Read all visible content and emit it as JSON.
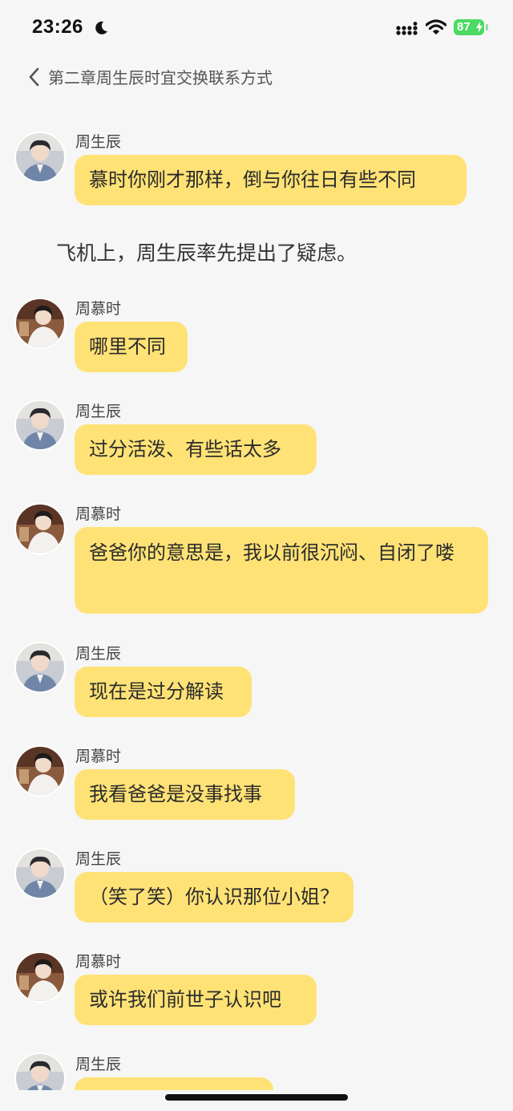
{
  "status_bar": {
    "time": "23:26",
    "battery_level": "87"
  },
  "nav": {
    "title": "第二章周生辰时宜交换联系方式"
  },
  "narration": "飞机上，周生辰率先提出了疑虑。",
  "messages": [
    {
      "speaker": "周生辰",
      "text": "慕时你刚才那样，倒与你往日有些不同"
    },
    {
      "speaker": "周慕时",
      "text": "哪里不同"
    },
    {
      "speaker": "周生辰",
      "text": "过分活泼、有些话太多"
    },
    {
      "speaker": "周慕时",
      "text": "爸爸你的意思是，我以前很沉闷、自闭了喽"
    },
    {
      "speaker": "周生辰",
      "text": "现在是过分解读"
    },
    {
      "speaker": "周慕时",
      "text": "我看爸爸是没事找事"
    },
    {
      "speaker": "周生辰",
      "text": "（笑了笑）你认识那位小姐？"
    },
    {
      "speaker": "周慕时",
      "text": "或许我们前世子认识吧"
    },
    {
      "speaker": "周生辰",
      "text": ""
    }
  ],
  "colors": {
    "bubble": "#ffe276",
    "battery": "#4cd964",
    "background": "#f6f6f6"
  }
}
